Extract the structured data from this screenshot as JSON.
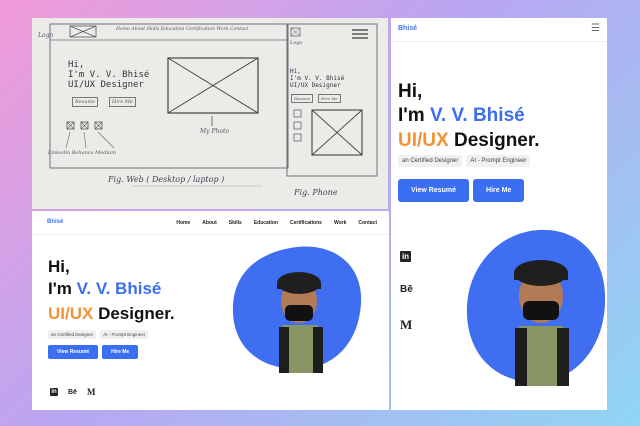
{
  "sketch": {
    "logo_note": "Logo",
    "nav_text": "Home About Skills Education Certification Work Contact",
    "hi": "Hi,",
    "name": "I'm V. V. Bhisé",
    "role": "UI/UX Designer",
    "btn_resume": "Resume",
    "btn_hire": "Hire Me",
    "photo_note": "My Photo",
    "icons_note": "Linkedin Behance Medium",
    "caption_web": "Fig. Web ( Desktop / laptop )",
    "caption_phone": "Fig. Phone",
    "phone_logo": "Logo",
    "phone_hi": "Hi,",
    "phone_name": "I'm V. V. Bhisé",
    "phone_role": "UI/UX Designer",
    "phone_btn_resume": "Resume",
    "phone_btn_hire": "Hire Me"
  },
  "desktop": {
    "logo": "Bhisé",
    "nav": [
      "Home",
      "About",
      "Skills",
      "Education",
      "Certifications",
      "Work",
      "Contact"
    ],
    "hi": "Hi,",
    "name_prefix": "I'm ",
    "name": "V. V. Bhisé",
    "role_highlight": "UI/UX",
    "role_rest": " Designer.",
    "tags": [
      "an Certified Designer",
      "AI - Prompt Engineer"
    ],
    "btn_resume": "View Resumé",
    "btn_hire": "Hire Me",
    "social": {
      "linkedin": "in",
      "behance": "Bē",
      "medium": "M"
    }
  },
  "phone": {
    "logo": "Bhisé",
    "menu_icon": "☰",
    "hi": "Hi,",
    "name_prefix": "I'm ",
    "name": "V. V. Bhisé",
    "role_highlight": "UI/UX",
    "role_rest": " Designer.",
    "tags": [
      "an Certified Designer",
      "AI - Prompt Engineer"
    ],
    "btn_resume": "View Resumé",
    "btn_hire": "Hire Me",
    "social": {
      "linkedin": "in",
      "behance": "Bē",
      "medium": "M"
    }
  },
  "colors": {
    "accent": "#3a6ff0",
    "orange": "#f39233",
    "blob": "#3f6ef0"
  }
}
